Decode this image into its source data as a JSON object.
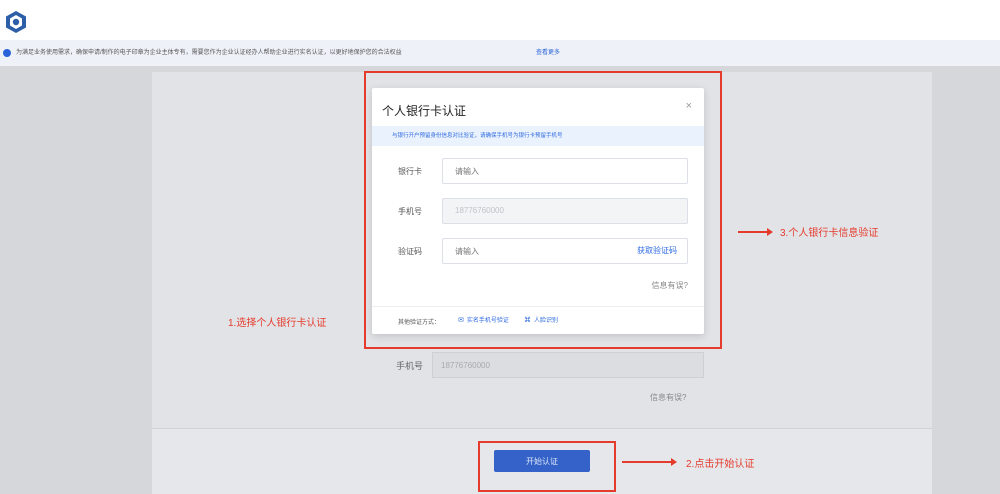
{
  "notice": {
    "text": "为满足业务使用需求，确保申请/制作的电子印章为企业主体专有，需要您作为企业认证经办人帮助企业进行实名认证，以更好地保护您的合法权益",
    "link": "查看更多"
  },
  "background": {
    "phone_label": "手机号",
    "phone_value": "18776760000",
    "info_wrong": "信息有误?",
    "start_button": "开始认证"
  },
  "modal": {
    "title": "个人银行卡认证",
    "close": "×",
    "tip": "与银行开户预留身份信息对比验证，请确保手机号为银行卡预留手机号",
    "fields": [
      {
        "label": "银行卡",
        "placeholder": "请输入"
      },
      {
        "label": "手机号",
        "value": "18776760000"
      },
      {
        "label": "验证码",
        "placeholder": "请输入"
      }
    ],
    "get_code": "获取验证码",
    "info_wrong": "信息有误?",
    "other_label": "其他验证方式：",
    "other_options": [
      "实名手机号验证",
      "人脸识别"
    ]
  },
  "annotations": {
    "step1": "1.选择个人银行卡认证",
    "step2": "2.点击开始认证",
    "step3": "3.个人银行卡信息验证"
  },
  "colors": {
    "accent": "#2f6be0",
    "annotation": "#e53b2d"
  }
}
